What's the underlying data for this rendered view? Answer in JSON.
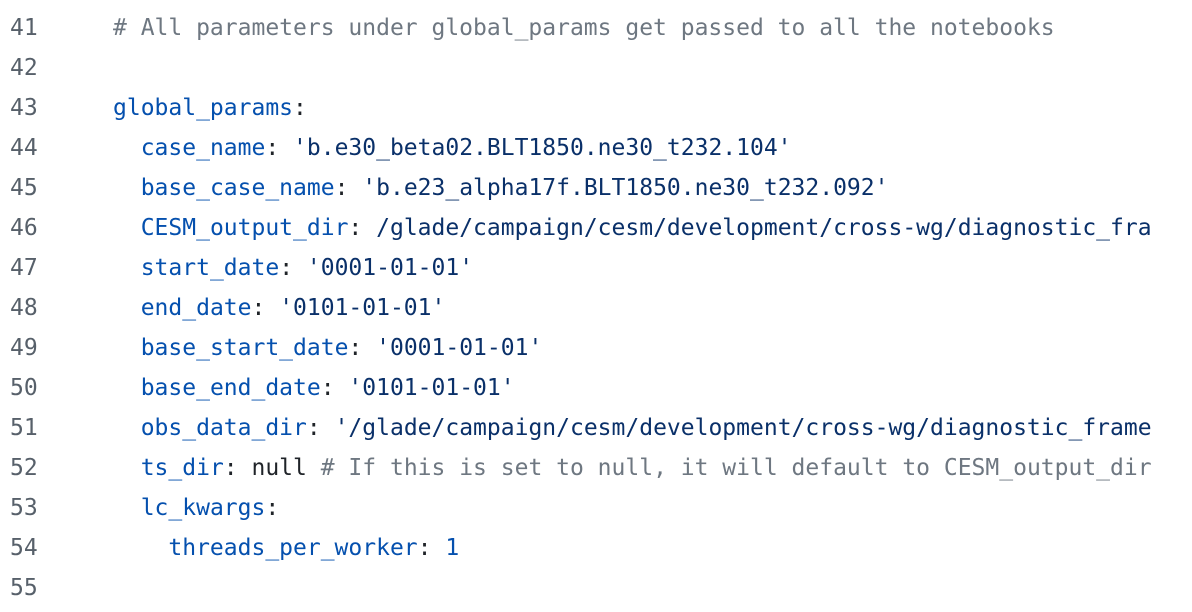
{
  "lines": [
    {
      "n": "41",
      "indent": "",
      "parts": [
        {
          "t": "cmt",
          "s": "# All parameters under global_params get passed to all the notebooks"
        }
      ]
    },
    {
      "n": "42",
      "indent": "",
      "parts": []
    },
    {
      "n": "43",
      "indent": "",
      "parts": [
        {
          "t": "key",
          "s": "global_params"
        },
        {
          "t": "plain",
          "s": ":"
        }
      ]
    },
    {
      "n": "44",
      "indent": "  ",
      "parts": [
        {
          "t": "key",
          "s": "case_name"
        },
        {
          "t": "plain",
          "s": ": "
        },
        {
          "t": "str",
          "s": "'b.e30_beta02.BLT1850.ne30_t232.104'"
        }
      ]
    },
    {
      "n": "45",
      "indent": "  ",
      "parts": [
        {
          "t": "key",
          "s": "base_case_name"
        },
        {
          "t": "plain",
          "s": ": "
        },
        {
          "t": "str",
          "s": "'b.e23_alpha17f.BLT1850.ne30_t232.092'"
        }
      ]
    },
    {
      "n": "46",
      "indent": "  ",
      "parts": [
        {
          "t": "key",
          "s": "CESM_output_dir"
        },
        {
          "t": "plain",
          "s": ": "
        },
        {
          "t": "str",
          "s": "/glade/campaign/cesm/development/cross-wg/diagnostic_fra"
        }
      ]
    },
    {
      "n": "47",
      "indent": "  ",
      "parts": [
        {
          "t": "key",
          "s": "start_date"
        },
        {
          "t": "plain",
          "s": ": "
        },
        {
          "t": "str",
          "s": "'0001-01-01'"
        }
      ]
    },
    {
      "n": "48",
      "indent": "  ",
      "parts": [
        {
          "t": "key",
          "s": "end_date"
        },
        {
          "t": "plain",
          "s": ": "
        },
        {
          "t": "str",
          "s": "'0101-01-01'"
        }
      ]
    },
    {
      "n": "49",
      "indent": "  ",
      "parts": [
        {
          "t": "key",
          "s": "base_start_date"
        },
        {
          "t": "plain",
          "s": ": "
        },
        {
          "t": "str",
          "s": "'0001-01-01'"
        }
      ]
    },
    {
      "n": "50",
      "indent": "  ",
      "parts": [
        {
          "t": "key",
          "s": "base_end_date"
        },
        {
          "t": "plain",
          "s": ": "
        },
        {
          "t": "str",
          "s": "'0101-01-01'"
        }
      ]
    },
    {
      "n": "51",
      "indent": "  ",
      "parts": [
        {
          "t": "key",
          "s": "obs_data_dir"
        },
        {
          "t": "plain",
          "s": ": "
        },
        {
          "t": "str",
          "s": "'/glade/campaign/cesm/development/cross-wg/diagnostic_frame"
        }
      ]
    },
    {
      "n": "52",
      "indent": "  ",
      "parts": [
        {
          "t": "key",
          "s": "ts_dir"
        },
        {
          "t": "plain",
          "s": ": null "
        },
        {
          "t": "cmt",
          "s": "# If this is set to null, it will default to CESM_output_dir"
        }
      ]
    },
    {
      "n": "53",
      "indent": "  ",
      "parts": [
        {
          "t": "key",
          "s": "lc_kwargs"
        },
        {
          "t": "plain",
          "s": ":"
        }
      ]
    },
    {
      "n": "54",
      "indent": "    ",
      "parts": [
        {
          "t": "key",
          "s": "threads_per_worker"
        },
        {
          "t": "plain",
          "s": ": "
        },
        {
          "t": "num",
          "s": "1"
        }
      ]
    },
    {
      "n": "55",
      "indent": "",
      "parts": []
    }
  ],
  "colors": {
    "key": "#0550ae",
    "string": "#0a3069",
    "comment": "#6e7781",
    "line_number": "#57606a",
    "text": "#1f2328"
  }
}
